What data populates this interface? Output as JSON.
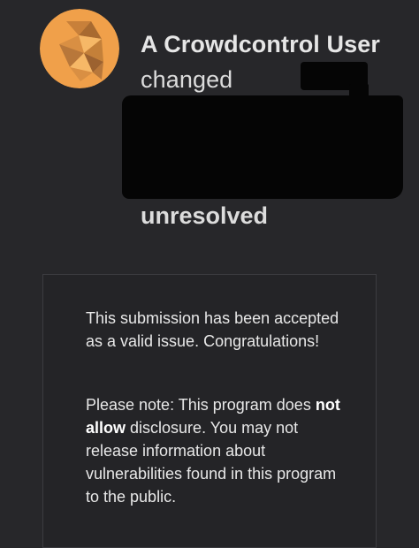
{
  "notification": {
    "actor_name": "A Crowdcontrol User",
    "action_text": "changed",
    "new_status": "unresolved"
  },
  "avatar": {
    "icon": "crowdcontrol-logo-icon",
    "background_color": "#f0a04a"
  },
  "card": {
    "accepted_message": "This submission has been accepted as a valid issue. Congratulations!",
    "disclosure_prefix": "Please note: This program does",
    "disclosure_emphasis": "not allow",
    "disclosure_suffix": "disclosure. You may not release information about vulnerabilities found in this program to the public."
  },
  "colors": {
    "background": "#27272a",
    "card_border": "#3c3c40",
    "redaction": "#050505"
  }
}
